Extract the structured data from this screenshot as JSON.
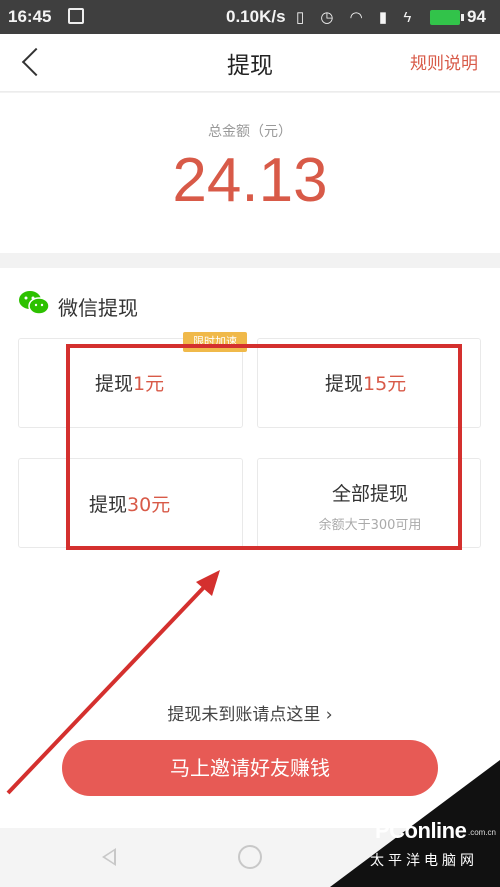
{
  "status_bar": {
    "time": "16:45",
    "speed": "0.10K/s",
    "battery_level": "94",
    "battery_color": "#32c34a"
  },
  "nav": {
    "title": "提现",
    "rules_link": "规则说明"
  },
  "balance": {
    "label": "总金额（元）",
    "value": "24.13"
  },
  "wechat": {
    "title": "微信提现",
    "badge": "限时加速",
    "options": [
      {
        "prefix": "提现",
        "amount": "1元"
      },
      {
        "prefix": "提现",
        "amount": "15元"
      },
      {
        "prefix": "提现",
        "amount": "30元"
      },
      {
        "label": "全部提现",
        "sub": "余额大于300可用"
      }
    ]
  },
  "help_link": "提现未到账请点这里 ›",
  "invite_button": "马上邀请好友赚钱",
  "watermark": {
    "logo": "PConline",
    "tld": ".com.cn",
    "cn": "太平洋电脑网"
  },
  "colors": {
    "accent": "#d85a48",
    "button": "#e75a55",
    "highlight": "#d4302e",
    "wechat_green": "#2dc100"
  }
}
